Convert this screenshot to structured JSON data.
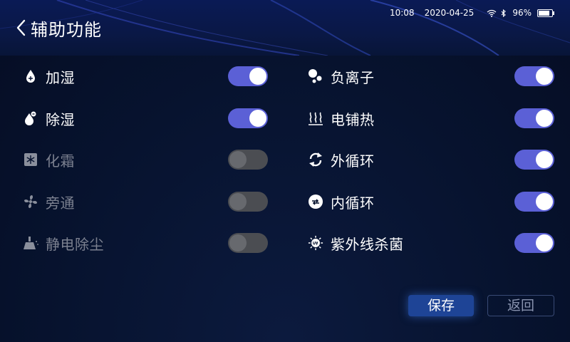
{
  "header": {
    "title": "辅助功能",
    "back_icon": "chevron-left-icon"
  },
  "status_bar": {
    "time": "10:08",
    "date": "2020-04-25",
    "wifi_icon": "wifi-icon",
    "bluetooth_icon": "bluetooth-icon",
    "battery_percent": "96%",
    "battery_level": 0.96
  },
  "left_options": [
    {
      "label": "加湿",
      "icon": "humidify-icon",
      "enabled": true,
      "state": "on"
    },
    {
      "label": "除湿",
      "icon": "dehumidify-icon",
      "enabled": true,
      "state": "on"
    },
    {
      "label": "化霜",
      "icon": "defrost-icon",
      "enabled": false,
      "state": "off"
    },
    {
      "label": "旁通",
      "icon": "fan-icon",
      "enabled": false,
      "state": "off"
    },
    {
      "label": "静电除尘",
      "icon": "dust-removal-icon",
      "enabled": false,
      "state": "off"
    }
  ],
  "right_options": [
    {
      "label": "负离子",
      "icon": "negative-ion-icon",
      "enabled": true,
      "state": "on"
    },
    {
      "label": "电铺热",
      "icon": "electric-heat-icon",
      "enabled": true,
      "state": "on"
    },
    {
      "label": "外循环",
      "icon": "external-circulation-icon",
      "enabled": true,
      "state": "on"
    },
    {
      "label": "内循环",
      "icon": "internal-circulation-icon",
      "enabled": true,
      "state": "on"
    },
    {
      "label": "紫外线杀菌",
      "icon": "uv-sterilize-icon",
      "enabled": true,
      "state": "on"
    }
  ],
  "buttons": {
    "save_label": "保存",
    "back_label": "返回"
  },
  "colors": {
    "toggle_on": "#5b60d6",
    "toggle_off": "#4b4d52",
    "save_button": "#1e4496"
  }
}
